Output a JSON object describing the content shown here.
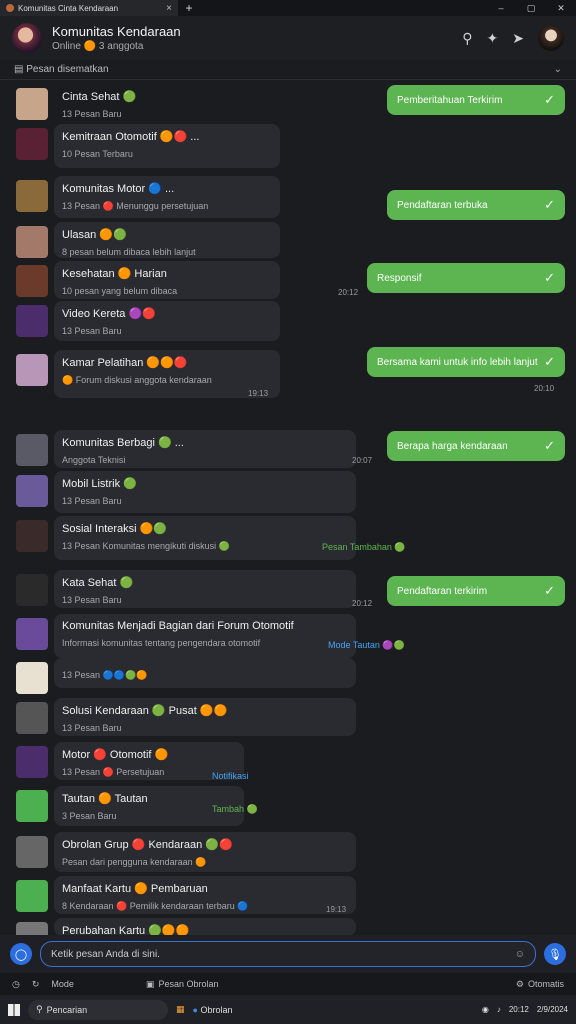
{
  "window": {
    "tab_title": "Komunitas Cinta Kendaraan",
    "new_tab": "+",
    "tab_close": "×",
    "controls": [
      "–",
      "▢",
      "✕"
    ]
  },
  "header": {
    "name": "Komunitas Kendaraan",
    "subtitle": "Online 🟠 3 anggota",
    "icons": [
      "search-icon",
      "share-icon",
      "forward-icon"
    ]
  },
  "pinned": {
    "text": "Pesan disematkan"
  },
  "incoming": [
    {
      "name": "Cinta Sehat 🟢",
      "sub": "13 Pesan Baru"
    },
    {
      "name": "Kemitraan Otomotif 🟠🔴 ...",
      "sub": "10 Pesan Terbaru"
    },
    {
      "name": "Komunitas Motor 🔵 ...",
      "sub": "13 Pesan 🔴 Menunggu persetujuan"
    },
    {
      "name": "Ulasan 🟠🟢",
      "sub": "8 pesan belum dibaca lebih lanjut"
    },
    {
      "name": "Kesehatan 🟠 Harian",
      "sub": "10 pesan yang belum dibaca"
    },
    {
      "name": "Video Kereta 🟣🔴",
      "sub": "13 Pesan Baru"
    },
    {
      "name": "Kamar Pelatihan 🟠🟠🔴",
      "sub": "🟠 Forum diskusi anggota kendaraan"
    },
    {
      "name": "Komunitas Berbagi 🟢 ...",
      "sub": "Anggota Teknisi"
    },
    {
      "name": "Mobil Listrik 🟢",
      "sub": "13 Pesan Baru"
    },
    {
      "name": "Sosial Interaksi 🟠🟢",
      "sub": "13 Pesan Komunitas mengikuti diskusi 🟢"
    },
    {
      "name": "Kata Sehat 🟢",
      "sub": "13 Pesan Baru"
    },
    {
      "name": "Komunitas Menjadi Bagian dari Forum Otomotif",
      "sub": "Informasi komunitas tentang pengendara otomotif"
    },
    {
      "name": "",
      "sub": "13 Pesan 🔵🔵🟢🟠"
    },
    {
      "name": "Solusi Kendaraan 🟢 Pusat 🟠🟠",
      "sub": "13 Pesan Baru"
    },
    {
      "name": "Motor 🔴 Otomotif 🟠",
      "sub": "13 Pesan 🔴 Persetujuan"
    },
    {
      "name": "Tautan 🟠 Tautan",
      "sub": "3 Pesan Baru"
    },
    {
      "name": "Obrolan Grup 🔴 Kendaraan 🟢🔴",
      "sub": "Pesan dari pengguna kendaraan 🟠"
    },
    {
      "name": "Manfaat Kartu 🟠 Pembaruan",
      "sub": "8 Kendaraan 🔴 Pemilik kendaraan terbaru 🔵"
    },
    {
      "name": "Perubahan Kartu 🟢🟠🟠",
      "sub": ""
    }
  ],
  "outgoing": [
    {
      "text": "Pemberitahuan Terkirim",
      "check": "✓"
    },
    {
      "text": "Pendaftaran terbuka",
      "check": "✓"
    },
    {
      "text": "Responsif",
      "check": "✓"
    },
    {
      "text": "Bersama kami untuk info lebih lanjut",
      "check": "✓"
    },
    {
      "text": "Berapa harga kendaraan",
      "check": "✓"
    },
    {
      "text": "Pendaftaran terkirim",
      "check": "✓"
    }
  ],
  "times": [
    "20:12",
    "19:13",
    "20:07",
    "20:12",
    "20:10",
    "19:13"
  ],
  "side_notes": [
    {
      "text": "Pesan Tambahan 🟢",
      "color": "#5cb550"
    },
    {
      "text": "Mode Tautan 🟣🟢",
      "color": "#42a5f5"
    },
    {
      "text": "Notifikasi",
      "color": "#42a5f5"
    },
    {
      "text": "Tambah 🟢",
      "color": "#5cb550"
    }
  ],
  "composer": {
    "placeholder": "Ketik pesan Anda di sini.",
    "mic": "🎙"
  },
  "toolbar": {
    "items": [
      "Mode",
      "Pesan Obrolan",
      "Otomatis"
    ]
  },
  "taskbar": {
    "search": "Pencarian",
    "app": "Obrolan",
    "time": "20:12",
    "date": "2/9/2024"
  }
}
